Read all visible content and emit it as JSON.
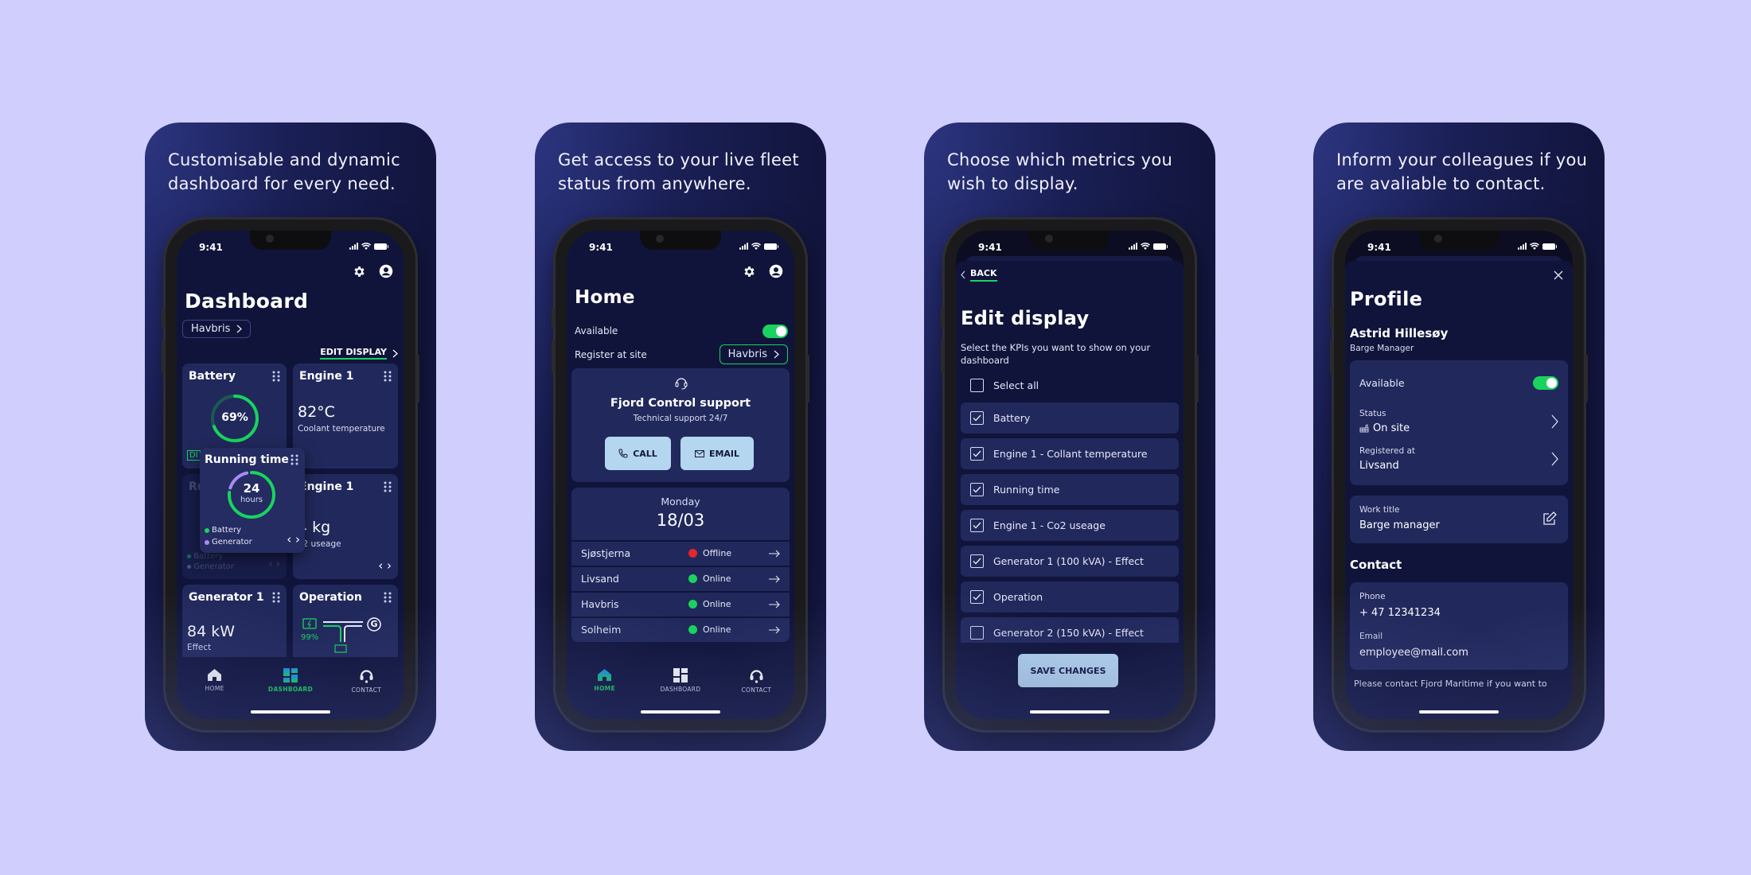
{
  "cards": [
    {
      "headline": "Customisable and dynamic dashboard for every need."
    },
    {
      "headline": "Get access to your live fleet status from anywhere."
    },
    {
      "headline": "Choose which metrics you wish to display."
    },
    {
      "headline": "Inform your colleagues if you are avaliable to contact."
    }
  ],
  "status_bar": {
    "time": "9:41"
  },
  "colors": {
    "accent_green": "#19d35e",
    "accent_purple": "#a98af2",
    "offline_red": "#e5262c",
    "button_light": "#b5d6ef",
    "tile_bg": "#21295c",
    "screen_bg": "#10143a"
  },
  "dashboard": {
    "title": "Dashboard",
    "site_selector": "Havbris",
    "edit_display": "EDIT DISPLAY",
    "tiles": {
      "battery": {
        "title": "Battery",
        "value": "69%",
        "progress": 0.69,
        "badge": "DI"
      },
      "engine_temp": {
        "title": "Engine 1",
        "value": "82°C",
        "label": "Coolant temperature"
      },
      "running_time_bg": {
        "title": "Ru",
        "legend": [
          "Battery",
          "Generator"
        ]
      },
      "engine_co2": {
        "title": "Engine 1",
        "value": "4 kg",
        "label": "o2 useage"
      },
      "generator": {
        "title": "Generator 1",
        "value": "84 kW",
        "label": "Effect"
      },
      "operation": {
        "title": "Operation",
        "battery_pct": "99%",
        "generator_glyph": "G"
      },
      "running_time_drag": {
        "title": "Running time",
        "value": "24",
        "unit": "hours",
        "battery_fraction": 0.8,
        "generator_fraction": 0.2,
        "legend": [
          "Battery",
          "Generator"
        ]
      }
    },
    "tabs": [
      {
        "label": "HOME"
      },
      {
        "label": "DASHBOARD",
        "active": true
      },
      {
        "label": "CONTACT"
      }
    ]
  },
  "home": {
    "title": "Home",
    "available_label": "Available",
    "available_on": true,
    "register_label": "Register at site",
    "register_value": "Havbris",
    "support": {
      "title": "Fjord Control support",
      "subtitle": "Technical support 24/7",
      "call": "CALL",
      "email": "EMAIL"
    },
    "date": {
      "day": "Monday",
      "date": "18/03"
    },
    "sites": [
      {
        "name": "Sjøstjerna",
        "status": "Offline"
      },
      {
        "name": "Livsand",
        "status": "Online"
      },
      {
        "name": "Havbris",
        "status": "Online"
      },
      {
        "name": "Solheim",
        "status": "Online"
      }
    ],
    "tabs": [
      {
        "label": "HOME",
        "active": true
      },
      {
        "label": "DASHBOARD"
      },
      {
        "label": "CONTACT"
      }
    ]
  },
  "edit": {
    "back": "BACK",
    "title": "Edit display",
    "description": "Select the KPIs you want to show on your dashboard",
    "select_all": "Select all",
    "items": [
      {
        "label": "Battery",
        "checked": true
      },
      {
        "label": "Engine 1 - Collant temperature",
        "checked": true
      },
      {
        "label": "Running time",
        "checked": true
      },
      {
        "label": "Engine 1 - Co2 useage",
        "checked": true
      },
      {
        "label": "Generator 1 (100 kVA) - Effect",
        "checked": true
      },
      {
        "label": "Operation",
        "checked": true
      },
      {
        "label": "Generator 2 (150 kVA) - Effect",
        "checked": false
      }
    ],
    "save": "SAVE CHANGES"
  },
  "profile": {
    "title": "Profile",
    "name": "Astrid Hillesøy",
    "role": "Barge Manager",
    "available_label": "Available",
    "available_on": true,
    "status_label": "Status",
    "status_value": "On site",
    "registered_label": "Registered at",
    "registered_value": "Livsand",
    "work_title_label": "Work title",
    "work_title_value": "Barge manager",
    "contact_heading": "Contact",
    "phone_label": "Phone",
    "phone_value": "+ 47 12341234",
    "email_label": "Email",
    "email_value": "employee@mail.com",
    "note": "Please contact Fjord Maritime if you want to"
  }
}
